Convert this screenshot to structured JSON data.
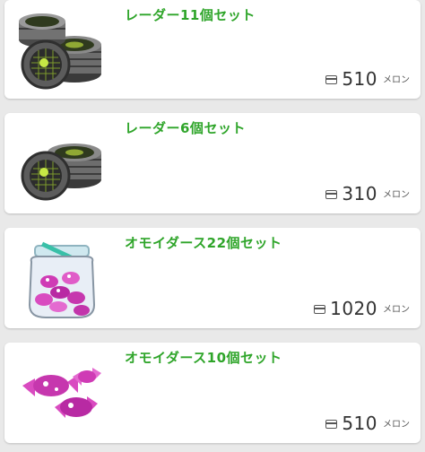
{
  "items": [
    {
      "name": "レーダー11個セット",
      "price": "510",
      "unit": "メロン",
      "icon": "radar-stack-icon"
    },
    {
      "name": "レーダー6個セット",
      "price": "310",
      "unit": "メロン",
      "icon": "radar-stack-icon"
    },
    {
      "name": "オモイダース22個セット",
      "price": "1020",
      "unit": "メロン",
      "icon": "candy-jar-icon"
    },
    {
      "name": "オモイダース10個セット",
      "price": "510",
      "unit": "メロン",
      "icon": "candy-icon"
    }
  ],
  "colors": {
    "title": "#2fa52a",
    "background": "#e9e9e9",
    "card": "#ffffff"
  }
}
